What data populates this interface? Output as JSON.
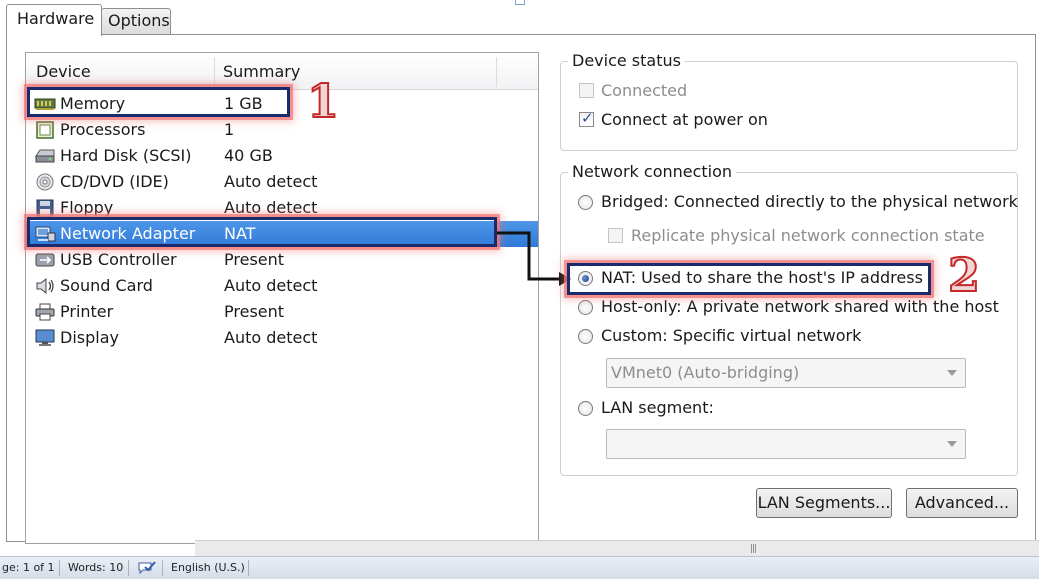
{
  "tabs": [
    {
      "label": "Hardware",
      "active": true
    },
    {
      "label": "Options",
      "active": false
    }
  ],
  "device_list": {
    "columns": [
      "Device",
      "Summary"
    ],
    "rows": [
      {
        "icon": "memory-icon",
        "device": "Memory",
        "summary": "1 GB"
      },
      {
        "icon": "processor-icon",
        "device": "Processors",
        "summary": "1"
      },
      {
        "icon": "hard-disk-icon",
        "device": "Hard Disk (SCSI)",
        "summary": "40 GB"
      },
      {
        "icon": "cd-dvd-icon",
        "device": "CD/DVD (IDE)",
        "summary": "Auto detect"
      },
      {
        "icon": "floppy-icon",
        "device": "Floppy",
        "summary": "Auto detect"
      },
      {
        "icon": "network-adapter-icon",
        "device": "Network Adapter",
        "summary": "NAT",
        "selected": true
      },
      {
        "icon": "usb-icon",
        "device": "USB Controller",
        "summary": "Present"
      },
      {
        "icon": "sound-icon",
        "device": "Sound Card",
        "summary": "Auto detect"
      },
      {
        "icon": "printer-icon",
        "device": "Printer",
        "summary": "Present"
      },
      {
        "icon": "display-icon",
        "device": "Display",
        "summary": "Auto detect"
      }
    ]
  },
  "device_status": {
    "title": "Device status",
    "connected": {
      "label": "Connected",
      "checked": false,
      "enabled": false
    },
    "connect_at_power_on": {
      "label": "Connect at power on",
      "checked": true,
      "enabled": true
    }
  },
  "network_connection": {
    "title": "Network connection",
    "bridged": {
      "label": "Bridged: Connected directly to the physical network",
      "selected": false
    },
    "replicate": {
      "label": "Replicate physical network connection state",
      "checked": false,
      "enabled": false
    },
    "nat": {
      "label": "NAT: Used to share the host's IP address",
      "selected": true
    },
    "host_only": {
      "label": "Host-only: A private network shared with the host",
      "selected": false
    },
    "custom": {
      "label": "Custom: Specific virtual network",
      "selected": false
    },
    "custom_combo_value": "VMnet0 (Auto-bridging)",
    "lan_segment": {
      "label": "LAN segment:",
      "selected": false
    },
    "lan_combo_value": ""
  },
  "buttons": {
    "lan_segments": "LAN Segments...",
    "advanced": "Advanced..."
  },
  "annotations": {
    "step1": "1",
    "step2": "2"
  },
  "status_bar": {
    "page": "ge: 1 of 1",
    "words": "Words: 10",
    "language": "English (U.S.)"
  },
  "colors": {
    "selection": "#3a84dd",
    "highlight_border": "#1b2a6b",
    "annotation_red": "#c62828"
  }
}
